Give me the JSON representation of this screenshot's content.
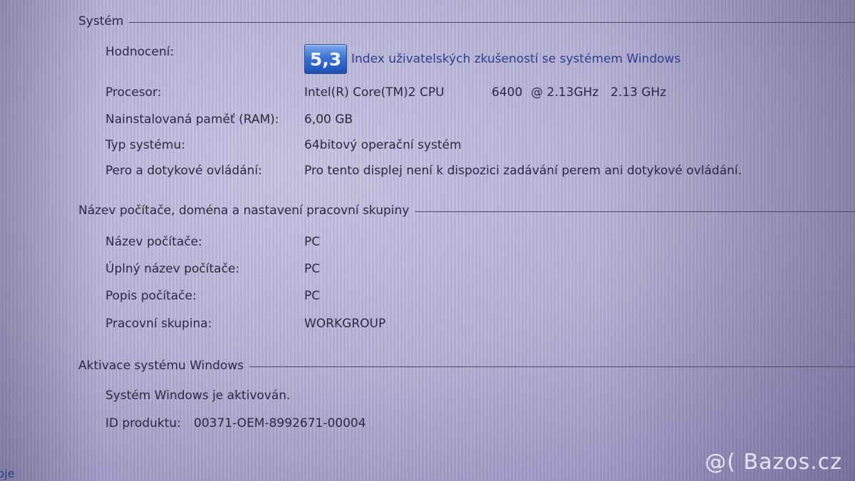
{
  "system_section": {
    "title": "Systém",
    "rating": {
      "label": "Hodnocení:",
      "score": "5,3",
      "link": "Index uživatelských zkušeností se systémem Windows"
    },
    "processor": {
      "label": "Procesor:",
      "model": "Intel(R) Core(TM)2 CPU",
      "number": "6400",
      "speed": "@ 2.13GHz",
      "speed2": "2.13 GHz"
    },
    "ram": {
      "label": "Nainstalovaná paměť (RAM):",
      "value": "6,00 GB"
    },
    "system_type": {
      "label": "Typ systému:",
      "value": "64bitový operační systém"
    },
    "pen_touch": {
      "label": "Pero a dotykové ovládání:",
      "value": "Pro tento displej není k dispozici zadávání perem ani dotykové ovládání."
    }
  },
  "computer_section": {
    "title": "Název počítače, doména a nastavení pracovní skupiny",
    "computer_name": {
      "label": "Název počítače:",
      "value": "PC"
    },
    "full_name": {
      "label": "Úplný název počítače:",
      "value": "PC"
    },
    "description": {
      "label": "Popis počítače:",
      "value": "PC"
    },
    "workgroup": {
      "label": "Pracovní skupina:",
      "value": "WORKGROUP"
    }
  },
  "activation_section": {
    "title": "Aktivace systému Windows",
    "status": "Systém Windows je aktivován.",
    "product_id": {
      "label": "ID produktu:",
      "value": "00371-OEM-8992671-00004"
    }
  },
  "left_edge_text": "bje",
  "watermark": "@( Bazos.cz"
}
